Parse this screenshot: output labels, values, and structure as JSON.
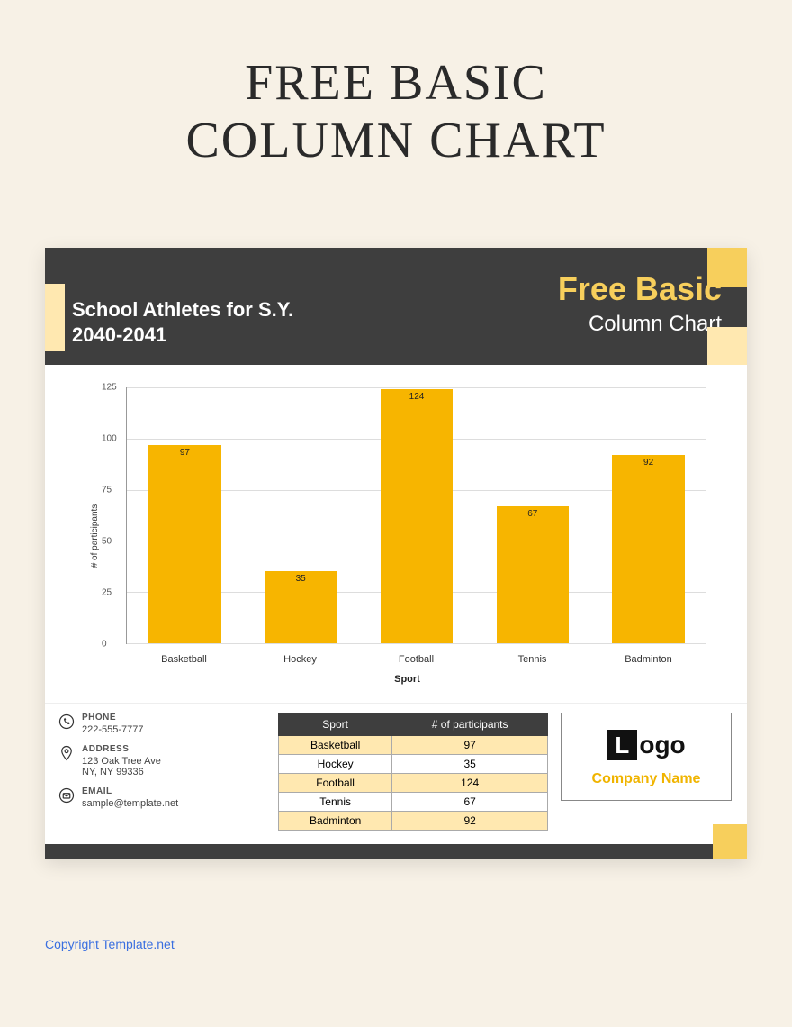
{
  "page_title_line1": "FREE BASIC",
  "page_title_line2": "COLUMN CHART",
  "header": {
    "left_subtitle": "School Athletes for S.Y. 2040-2041",
    "right_line1": "Free Basic",
    "right_line2": "Column Chart"
  },
  "chart_data": {
    "type": "bar",
    "categories": [
      "Basketball",
      "Hockey",
      "Football",
      "Tennis",
      "Badminton"
    ],
    "values": [
      97,
      35,
      124,
      67,
      92
    ],
    "xlabel": "Sport",
    "ylabel": "# of participants",
    "ylim": [
      0,
      125
    ],
    "yticks": [
      0,
      25,
      50,
      75,
      100,
      125
    ],
    "bar_color": "#f7b500"
  },
  "table": {
    "col1": "Sport",
    "col2": "# of participants"
  },
  "contact": {
    "phone_label": "PHONE",
    "phone_value": "222-555-7777",
    "address_label": "ADDRESS",
    "address_line1": "123 Oak Tree Ave",
    "address_line2": "NY, NY 99336",
    "email_label": "EMAIL",
    "email_value": "sample@template.net"
  },
  "logo": {
    "mark_letter": "L",
    "word": "ogo",
    "company": "Company Name"
  },
  "copyright": "Copyright Template.net"
}
